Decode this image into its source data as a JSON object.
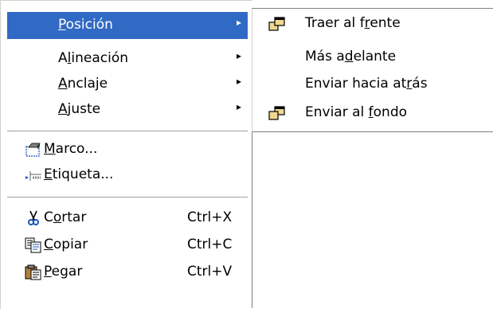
{
  "main_menu": {
    "items": [
      {
        "pre": "",
        "key": "P",
        "post": "osición",
        "arrow": "▸",
        "highlight": true
      },
      {
        "pre": "A",
        "key": "l",
        "post": "ineación",
        "arrow": "▸"
      },
      {
        "pre": "",
        "key": "A",
        "post": "nclaje",
        "arrow": "▸"
      },
      {
        "pre": "",
        "key": "A",
        "post": "juste",
        "arrow": "▸"
      },
      {
        "pre": "",
        "key": "M",
        "post": "arco...",
        "icon": "frame-icon"
      },
      {
        "pre": "",
        "key": "E",
        "post": "tiqueta...",
        "icon": "label-icon"
      },
      {
        "pre": "C",
        "key": "o",
        "post": "rtar",
        "shortcut": "Ctrl+X",
        "icon": "scissors-icon"
      },
      {
        "pre": "",
        "key": "C",
        "post": "opiar",
        "shortcut": "Ctrl+C",
        "icon": "copy-icon"
      },
      {
        "pre": "",
        "key": "P",
        "post": "egar",
        "shortcut": "Ctrl+V",
        "icon": "paste-icon"
      }
    ]
  },
  "sub_menu": {
    "items": [
      {
        "pre": "Traer al f",
        "key": "r",
        "post": "ente",
        "icon": "bring-to-front-icon"
      },
      {
        "pre": "Más a",
        "key": "d",
        "post": "elante"
      },
      {
        "pre": "Enviar hacia at",
        "key": "r",
        "post": "ás"
      },
      {
        "pre": "Enviar al ",
        "key": "f",
        "post": "ondo",
        "icon": "send-to-back-icon"
      }
    ]
  },
  "colors": {
    "highlight": "#316ac5",
    "highlight_text": "#ffffff"
  }
}
